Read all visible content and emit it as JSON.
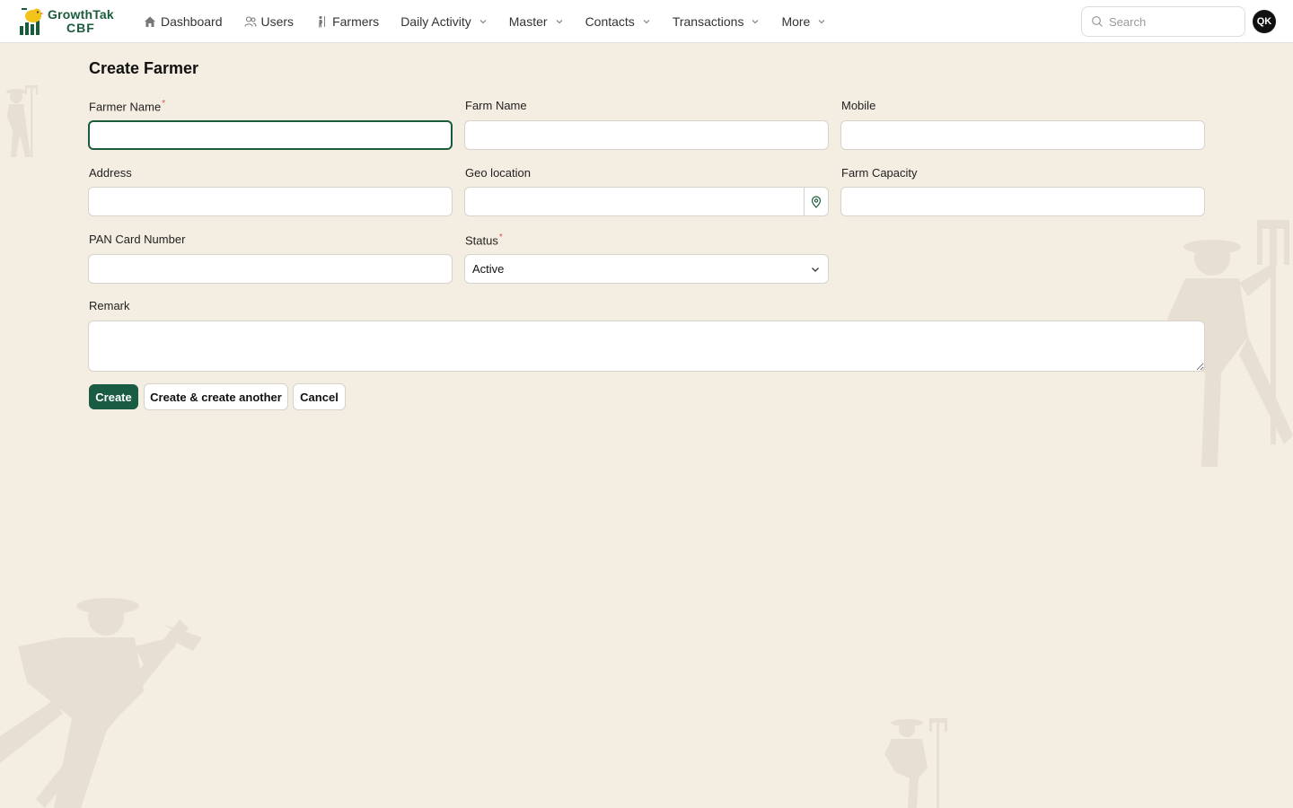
{
  "app": {
    "brand_name": "GrowthTak",
    "brand_sub": "CBF",
    "accent_color": "#1a5b43"
  },
  "nav": {
    "items": [
      {
        "label": "Dashboard",
        "icon": "home-icon"
      },
      {
        "label": "Users",
        "icon": "users-icon"
      },
      {
        "label": "Farmers",
        "icon": "farmer-icon"
      },
      {
        "label": "Daily Activity",
        "icon": "chevron-down-icon"
      },
      {
        "label": "Master",
        "icon": "chevron-down-icon"
      },
      {
        "label": "Contacts",
        "icon": "chevron-down-icon"
      },
      {
        "label": "Transactions",
        "icon": "chevron-down-icon"
      },
      {
        "label": "More",
        "icon": "chevron-down-icon"
      }
    ]
  },
  "search": {
    "placeholder": "Search"
  },
  "user": {
    "initials": "QK"
  },
  "form": {
    "title": "Create Farmer",
    "fields": {
      "farmer_name": {
        "label": "Farmer Name",
        "required": "*",
        "value": ""
      },
      "farm_name": {
        "label": "Farm Name",
        "value": ""
      },
      "mobile": {
        "label": "Mobile",
        "value": ""
      },
      "address": {
        "label": "Address",
        "value": ""
      },
      "geo_location": {
        "label": "Geo location",
        "value": ""
      },
      "farm_capacity": {
        "label": "Farm Capacity",
        "value": ""
      },
      "pan_card": {
        "label": "PAN Card Number",
        "value": ""
      },
      "status": {
        "label": "Status",
        "required": "*",
        "value": "Active"
      },
      "remark": {
        "label": "Remark",
        "value": ""
      }
    },
    "buttons": {
      "create": "Create",
      "create_another": "Create & create another",
      "cancel": "Cancel"
    }
  }
}
